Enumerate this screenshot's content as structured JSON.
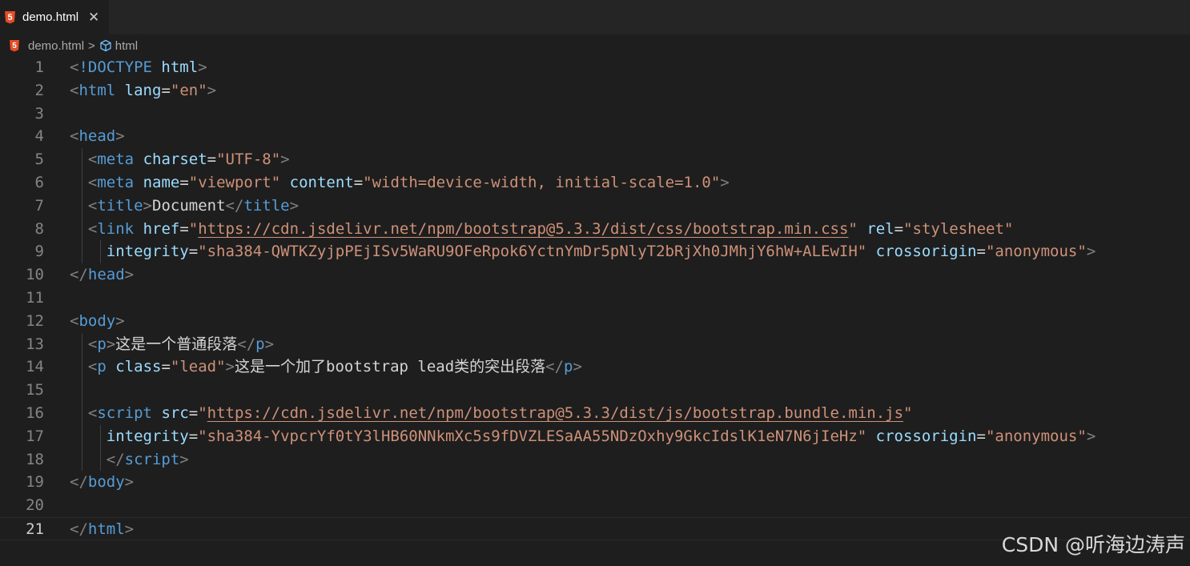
{
  "tab": {
    "label": "demo.html",
    "close_glyph": "✕",
    "file_icon": "html5-icon"
  },
  "breadcrumb": {
    "file": "demo.html",
    "separator": ">",
    "symbol": "html",
    "symbol_icon": "cube-icon"
  },
  "colors": {
    "tag": "#569cd6",
    "attr": "#9cdcfe",
    "string": "#ce9178",
    "punct": "#808080",
    "text": "#d4d4d4",
    "background": "#1e1e1e"
  },
  "current_line": 21,
  "lines": [
    {
      "n": 1,
      "tokens": [
        [
          "p",
          "<"
        ],
        [
          "tag",
          "!DOCTYPE"
        ],
        [
          "text",
          " "
        ],
        [
          "attr",
          "html"
        ],
        [
          "p",
          ">"
        ]
      ]
    },
    {
      "n": 2,
      "tokens": [
        [
          "p",
          "<"
        ],
        [
          "tag",
          "html"
        ],
        [
          "text",
          " "
        ],
        [
          "attr",
          "lang"
        ],
        [
          "text",
          "="
        ],
        [
          "str",
          "\"en\""
        ],
        [
          "p",
          ">"
        ]
      ]
    },
    {
      "n": 3,
      "tokens": []
    },
    {
      "n": 4,
      "tokens": [
        [
          "p",
          "<"
        ],
        [
          "tag",
          "head"
        ],
        [
          "p",
          ">"
        ]
      ]
    },
    {
      "n": 5,
      "tokens": [
        [
          "text",
          "  "
        ],
        [
          "p",
          "<"
        ],
        [
          "tag",
          "meta"
        ],
        [
          "text",
          " "
        ],
        [
          "attr",
          "charset"
        ],
        [
          "text",
          "="
        ],
        [
          "str",
          "\"UTF-8\""
        ],
        [
          "p",
          ">"
        ]
      ]
    },
    {
      "n": 6,
      "tokens": [
        [
          "text",
          "  "
        ],
        [
          "p",
          "<"
        ],
        [
          "tag",
          "meta"
        ],
        [
          "text",
          " "
        ],
        [
          "attr",
          "name"
        ],
        [
          "text",
          "="
        ],
        [
          "str",
          "\"viewport\""
        ],
        [
          "text",
          " "
        ],
        [
          "attr",
          "content"
        ],
        [
          "text",
          "="
        ],
        [
          "str",
          "\"width=device-width, initial-scale=1.0\""
        ],
        [
          "p",
          ">"
        ]
      ]
    },
    {
      "n": 7,
      "tokens": [
        [
          "text",
          "  "
        ],
        [
          "p",
          "<"
        ],
        [
          "tag",
          "title"
        ],
        [
          "p",
          ">"
        ],
        [
          "text",
          "Document"
        ],
        [
          "p",
          "</"
        ],
        [
          "tag",
          "title"
        ],
        [
          "p",
          ">"
        ]
      ]
    },
    {
      "n": 8,
      "tokens": [
        [
          "text",
          "  "
        ],
        [
          "p",
          "<"
        ],
        [
          "tag",
          "link"
        ],
        [
          "text",
          " "
        ],
        [
          "attr",
          "href"
        ],
        [
          "text",
          "="
        ],
        [
          "str",
          "\""
        ],
        [
          "link",
          "https://cdn.jsdelivr.net/npm/bootstrap@5.3.3/dist/css/bootstrap.min.css"
        ],
        [
          "str",
          "\""
        ],
        [
          "text",
          " "
        ],
        [
          "attr",
          "rel"
        ],
        [
          "text",
          "="
        ],
        [
          "str",
          "\"stylesheet\""
        ]
      ]
    },
    {
      "n": 9,
      "tokens": [
        [
          "text",
          "    "
        ],
        [
          "attr",
          "integrity"
        ],
        [
          "text",
          "="
        ],
        [
          "str",
          "\"sha384-QWTKZyjpPEjISv5WaRU9OFeRpok6YctnYmDr5pNlyT2bRjXh0JMhjY6hW+ALEwIH\""
        ],
        [
          "text",
          " "
        ],
        [
          "attr",
          "crossorigin"
        ],
        [
          "text",
          "="
        ],
        [
          "str",
          "\"anonymous\""
        ],
        [
          "p",
          ">"
        ]
      ]
    },
    {
      "n": 10,
      "tokens": [
        [
          "p",
          "</"
        ],
        [
          "tag",
          "head"
        ],
        [
          "p",
          ">"
        ]
      ]
    },
    {
      "n": 11,
      "tokens": []
    },
    {
      "n": 12,
      "tokens": [
        [
          "p",
          "<"
        ],
        [
          "tag",
          "body"
        ],
        [
          "p",
          ">"
        ]
      ]
    },
    {
      "n": 13,
      "tokens": [
        [
          "text",
          "  "
        ],
        [
          "p",
          "<"
        ],
        [
          "tag",
          "p"
        ],
        [
          "p",
          ">"
        ],
        [
          "text",
          "这是一个普通段落"
        ],
        [
          "p",
          "</"
        ],
        [
          "tag",
          "p"
        ],
        [
          "p",
          ">"
        ]
      ]
    },
    {
      "n": 14,
      "tokens": [
        [
          "text",
          "  "
        ],
        [
          "p",
          "<"
        ],
        [
          "tag",
          "p"
        ],
        [
          "text",
          " "
        ],
        [
          "attr",
          "class"
        ],
        [
          "text",
          "="
        ],
        [
          "str",
          "\"lead\""
        ],
        [
          "p",
          ">"
        ],
        [
          "text",
          "这是一个加了bootstrap lead类的突出段落"
        ],
        [
          "p",
          "</"
        ],
        [
          "tag",
          "p"
        ],
        [
          "p",
          ">"
        ]
      ]
    },
    {
      "n": 15,
      "tokens": []
    },
    {
      "n": 16,
      "tokens": [
        [
          "text",
          "  "
        ],
        [
          "p",
          "<"
        ],
        [
          "tag",
          "script"
        ],
        [
          "text",
          " "
        ],
        [
          "attr",
          "src"
        ],
        [
          "text",
          "="
        ],
        [
          "str",
          "\""
        ],
        [
          "link",
          "https://cdn.jsdelivr.net/npm/bootstrap@5.3.3/dist/js/bootstrap.bundle.min.js"
        ],
        [
          "str",
          "\""
        ]
      ]
    },
    {
      "n": 17,
      "tokens": [
        [
          "text",
          "    "
        ],
        [
          "attr",
          "integrity"
        ],
        [
          "text",
          "="
        ],
        [
          "str",
          "\"sha384-YvpcrYf0tY3lHB60NNkmXc5s9fDVZLESaAA55NDzOxhy9GkcIdslK1eN7N6jIeHz\""
        ],
        [
          "text",
          " "
        ],
        [
          "attr",
          "crossorigin"
        ],
        [
          "text",
          "="
        ],
        [
          "str",
          "\"anonymous\""
        ],
        [
          "p",
          ">"
        ]
      ]
    },
    {
      "n": 18,
      "tokens": [
        [
          "text",
          "    "
        ],
        [
          "p",
          "</"
        ],
        [
          "tag",
          "script"
        ],
        [
          "p",
          ">"
        ]
      ]
    },
    {
      "n": 19,
      "tokens": [
        [
          "p",
          "</"
        ],
        [
          "tag",
          "body"
        ],
        [
          "p",
          ">"
        ]
      ]
    },
    {
      "n": 20,
      "tokens": []
    },
    {
      "n": 21,
      "tokens": [
        [
          "p",
          "</"
        ],
        [
          "tag",
          "html"
        ],
        [
          "p",
          ">"
        ]
      ]
    }
  ],
  "watermark": "CSDN @听海边涛声"
}
